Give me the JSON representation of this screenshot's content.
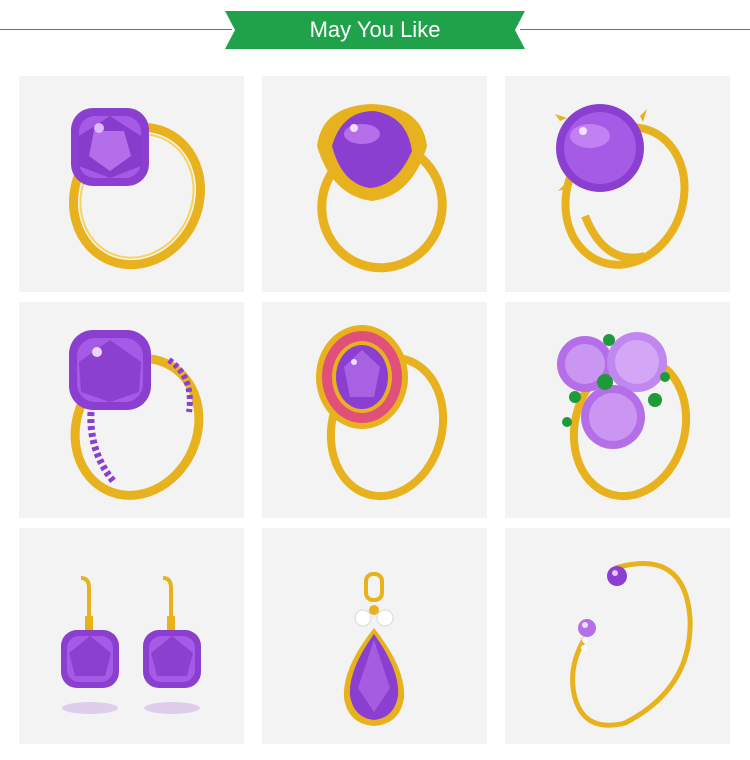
{
  "header": {
    "title": "May You Like",
    "accent_color": "#1fa24a"
  },
  "products": [
    {
      "icon": "amethyst-faceted-cushion-ring-icon"
    },
    {
      "icon": "amethyst-pear-cabochon-signet-ring-icon"
    },
    {
      "icon": "amethyst-round-cabochon-ring-icon"
    },
    {
      "icon": "amethyst-cushion-pave-ring-icon"
    },
    {
      "icon": "amethyst-oval-halo-ring-icon"
    },
    {
      "icon": "amethyst-cluster-emerald-ring-icon"
    },
    {
      "icon": "amethyst-drop-earrings-icon"
    },
    {
      "icon": "amethyst-pear-pendant-icon"
    },
    {
      "icon": "amethyst-open-bangle-icon"
    }
  ],
  "colors": {
    "gold": "#e8b21e",
    "gold_dark": "#b8860b",
    "amethyst": "#8a3fd0",
    "amethyst_light": "#c07af0",
    "emerald": "#1f9a3a",
    "ruby": "#e0507a",
    "tile_bg": "#f3f3f3"
  }
}
